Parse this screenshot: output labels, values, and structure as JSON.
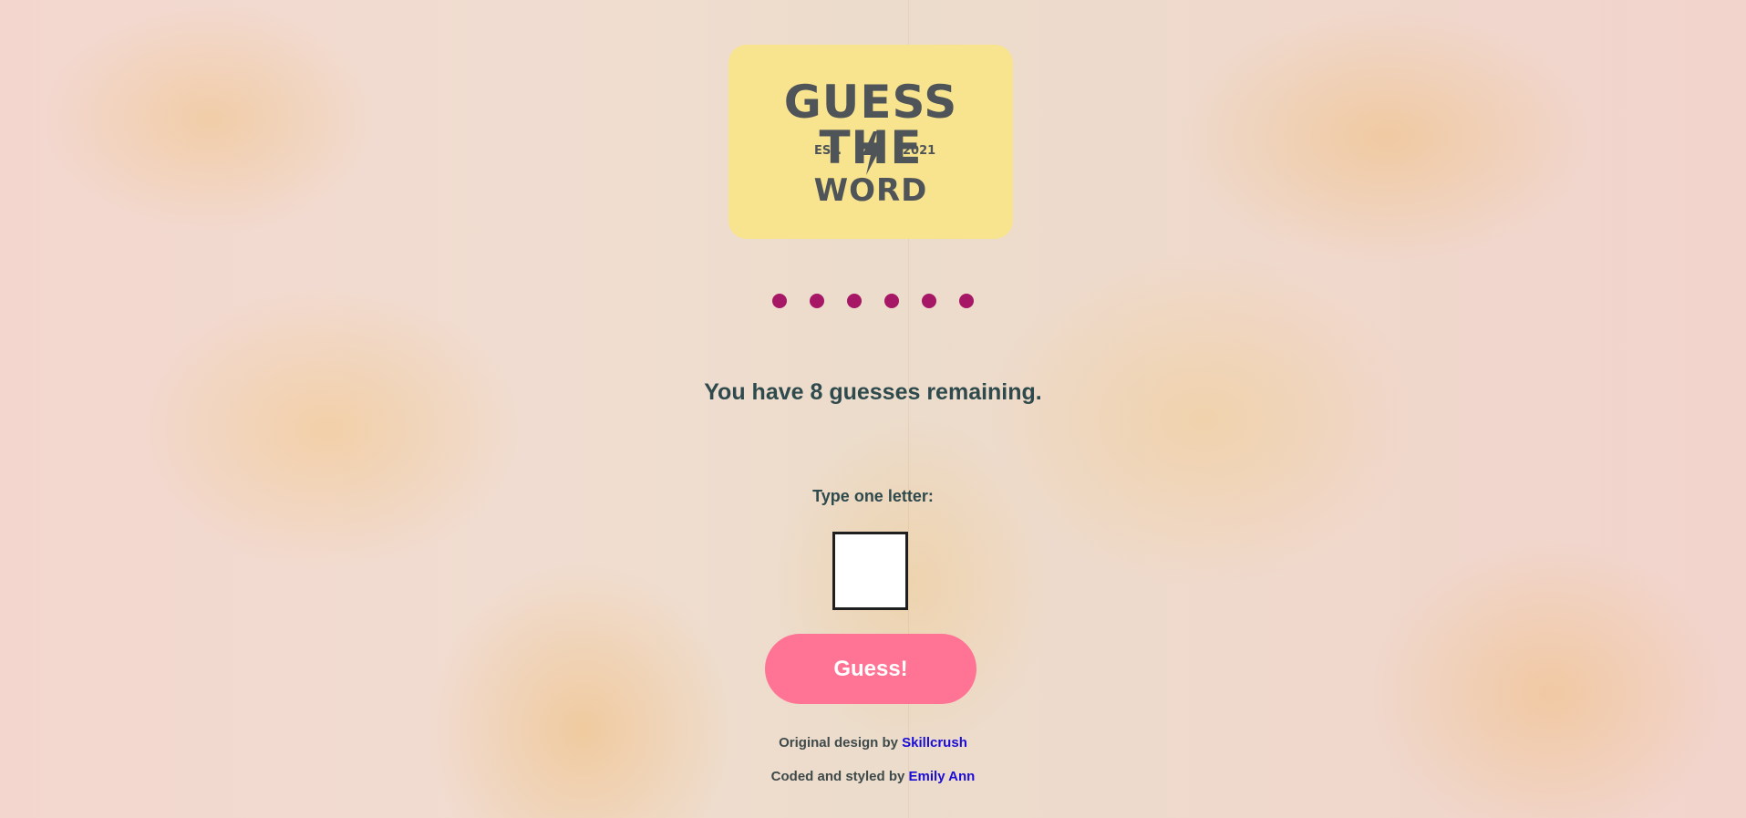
{
  "logo": {
    "line1": "GUESS THE",
    "est": "EST.",
    "year": "2021",
    "line2": "WORD",
    "bolt_icon": "lightning-bolt-icon"
  },
  "word_in_progress": {
    "hidden_letters": [
      "●",
      "●",
      "●",
      "●",
      "●",
      "●"
    ]
  },
  "status": {
    "remaining_text": "You have 8 guesses remaining."
  },
  "guess_form": {
    "label": "Type one letter:",
    "input_value": "",
    "button_label": "Guess!"
  },
  "credits": {
    "line1_prefix": "Original design by",
    "line1_link": "Skillcrush",
    "line2_prefix": "Coded and styled by",
    "line2_link": "Emily Ann"
  },
  "colors": {
    "dot": "#a61766",
    "button": "#ff7494",
    "logo_bg": "#f8e38f",
    "text": "#2f4a4d",
    "link": "#1a0dd6"
  }
}
